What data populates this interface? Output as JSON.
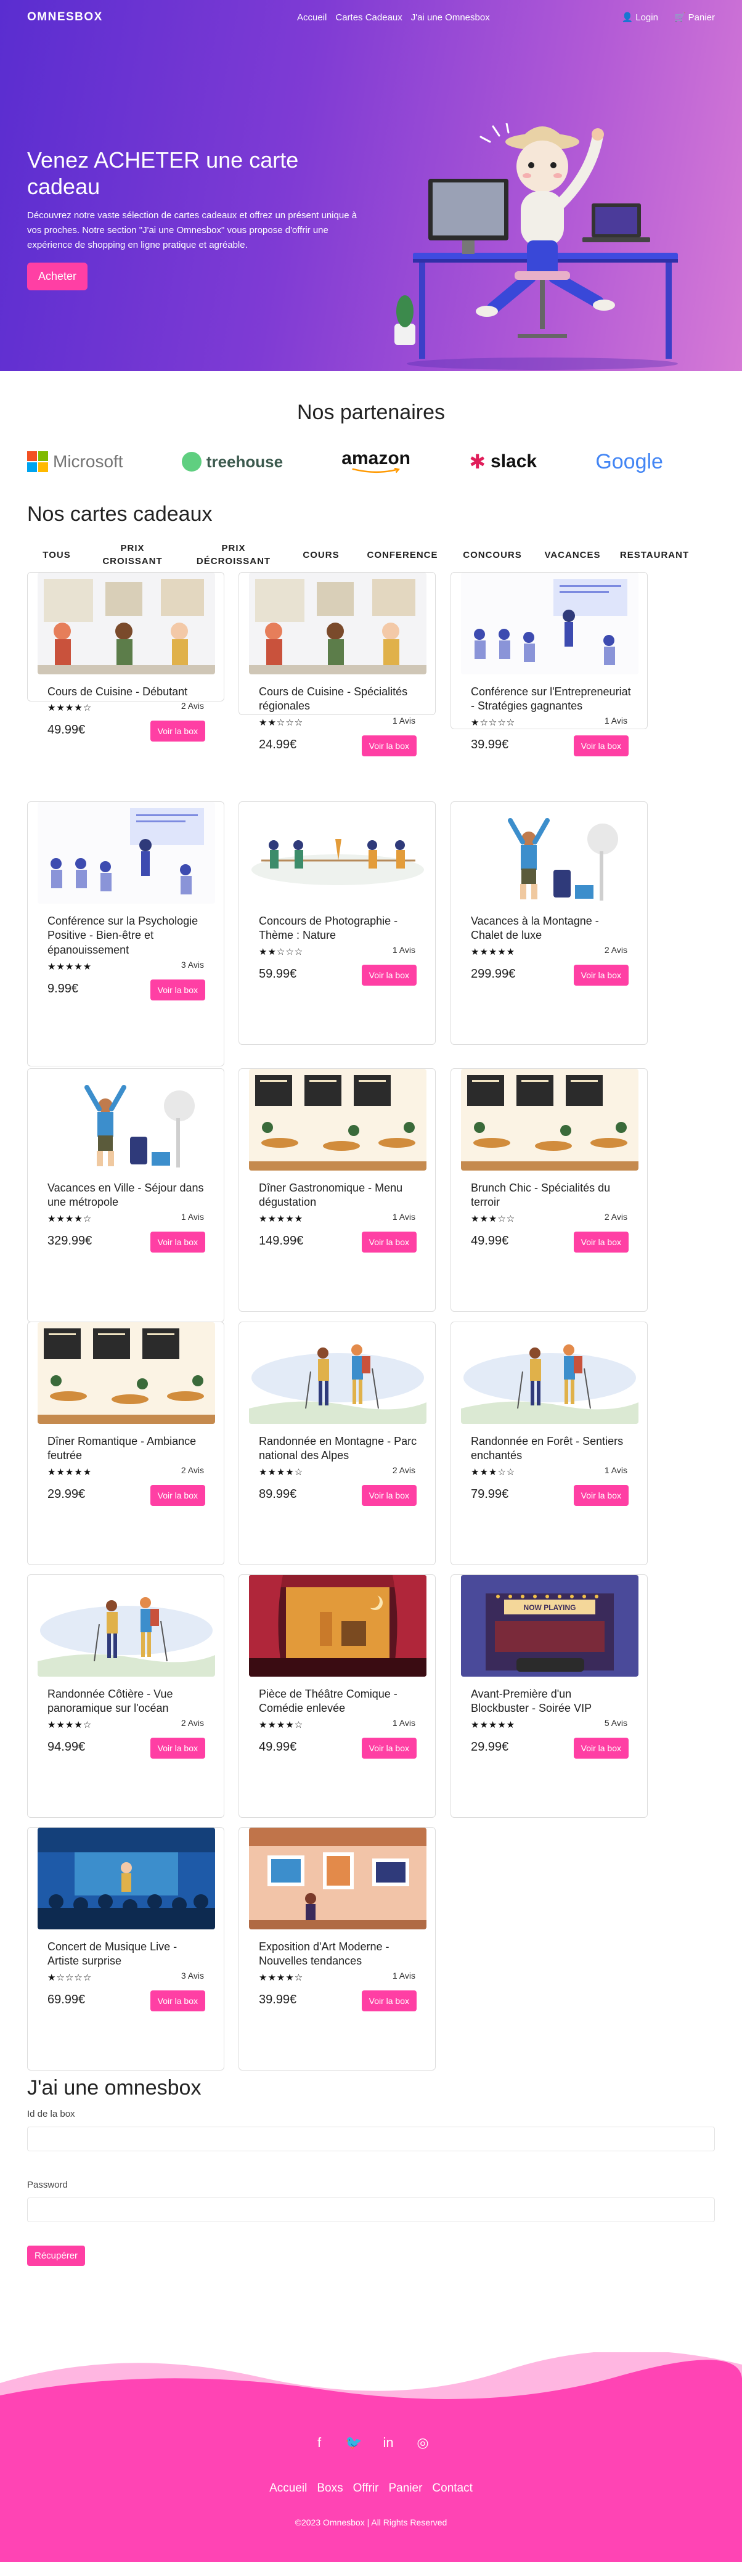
{
  "nav": {
    "brand": "OMNESBOX",
    "links": [
      "Accueil",
      "Cartes Cadeaux",
      "J'ai une Omnesbox"
    ],
    "login": "Login",
    "cart": "Panier"
  },
  "hero": {
    "title": "Venez ACHETER une carte cadeau",
    "description": "Découvrez notre vaste sélection de cartes cadeaux et offrez un présent unique à vos proches. Notre section \"J'ai une Omnesbox\" vous propose d'offrir une expérience de shopping en ligne pratique et agréable.",
    "button": "Acheter"
  },
  "partners": {
    "title": "Nos partenaires",
    "logos": [
      "Microsoft",
      "treehouse",
      "amazon",
      "slack",
      "Google"
    ]
  },
  "cards_section": {
    "title": "Nos cartes cadeaux",
    "tabs": [
      "TOUS",
      "PRIX CROISSANT",
      "PRIX DÉCROISSANT",
      "COURS",
      "CONFERENCE",
      "CONCOURS",
      "VACANCES",
      "RESTAURANT"
    ],
    "button_label": "Voir la box",
    "cards": [
      {
        "title": "Cours de Cuisine - Débutant",
        "rating": 4,
        "reviews": "2 Avis",
        "price": "49.99€",
        "image": "cooking-class"
      },
      {
        "title": "Cours de Cuisine - Spécialités régionales",
        "rating": 2,
        "reviews": "1 Avis",
        "price": "24.99€",
        "image": "cooking-class"
      },
      {
        "title": "Conférence sur l'Entrepreneuriat - Stratégies gagnantes",
        "rating": 1,
        "reviews": "1 Avis",
        "price": "39.99€",
        "image": "conference"
      },
      {
        "title": "Conférence sur la Psychologie Positive - Bien-être et épanouissement",
        "rating": 5,
        "reviews": "3 Avis",
        "price": "9.99€",
        "image": "conference"
      },
      {
        "title": "Concours de Photographie - Thème : Nature",
        "rating": 2,
        "reviews": "1 Avis",
        "price": "59.99€",
        "image": "tug-of-war"
      },
      {
        "title": "Vacances à la Montagne - Chalet de luxe",
        "rating": 5,
        "reviews": "2 Avis",
        "price": "299.99€",
        "image": "vacation"
      },
      {
        "title": "Vacances en Ville - Séjour dans une métropole",
        "rating": 4,
        "reviews": "1 Avis",
        "price": "329.99€",
        "image": "vacation"
      },
      {
        "title": "Dîner Gastronomique - Menu dégustation",
        "rating": 5,
        "reviews": "1 Avis",
        "price": "149.99€",
        "image": "restaurant"
      },
      {
        "title": "Brunch Chic - Spécialités du terroir",
        "rating": 3,
        "reviews": "2 Avis",
        "price": "49.99€",
        "image": "restaurant"
      },
      {
        "title": "Dîner Romantique - Ambiance feutrée",
        "rating": 5,
        "reviews": "2 Avis",
        "price": "29.99€",
        "image": "restaurant"
      },
      {
        "title": "Randonnée en Montagne - Parc national des Alpes",
        "rating": 4,
        "reviews": "2 Avis",
        "price": "89.99€",
        "image": "hiking"
      },
      {
        "title": "Randonnée en Forêt - Sentiers enchantés",
        "rating": 3,
        "reviews": "1 Avis",
        "price": "79.99€",
        "image": "hiking"
      },
      {
        "title": "Randonnée Côtière - Vue panoramique sur l'océan",
        "rating": 4,
        "reviews": "2 Avis",
        "price": "94.99€",
        "image": "hiking"
      },
      {
        "title": "Pièce de Théâtre Comique - Comédie enlevée",
        "rating": 4,
        "reviews": "1 Avis",
        "price": "49.99€",
        "image": "theater"
      },
      {
        "title": "Avant-Première d'un Blockbuster - Soirée VIP",
        "rating": 5,
        "reviews": "5 Avis",
        "price": "29.99€",
        "image": "cinema"
      },
      {
        "title": "Concert de Musique Live - Artiste surprise",
        "rating": 1,
        "reviews": "3 Avis",
        "price": "69.99€",
        "image": "concert"
      },
      {
        "title": "Exposition d'Art Moderne - Nouvelles tendances",
        "rating": 4,
        "reviews": "1 Avis",
        "price": "39.99€",
        "image": "art-gallery"
      }
    ],
    "cinema_sign": "NOW PLAYING"
  },
  "redeem": {
    "title": "J'ai une omnesbox",
    "id_label": "Id de la box",
    "password_label": "Password",
    "submit": "Récupérer"
  },
  "footer": {
    "social": [
      "facebook-icon",
      "twitter-icon",
      "linkedin-icon",
      "instagram-icon"
    ],
    "links": [
      "Accueil",
      "Boxs",
      "Offrir",
      "Panier",
      "Contact"
    ],
    "copyright": "©2023 Omnesbox | All Rights Reserved"
  },
  "colors": {
    "accent": "#ff3fa4",
    "hero_start": "#5a2dd0",
    "hero_end": "#d67ad6",
    "footer": "#ff44b4"
  }
}
